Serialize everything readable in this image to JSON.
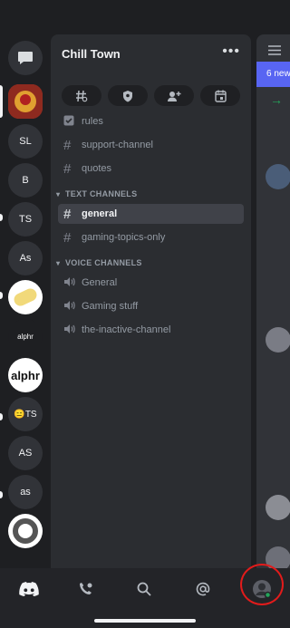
{
  "server": {
    "name": "Chill Town",
    "more_label": "•••"
  },
  "rail": {
    "servers": [
      {
        "label": ""
      },
      {
        "label": ""
      },
      {
        "label": "SL"
      },
      {
        "label": "B"
      },
      {
        "label": "TS"
      },
      {
        "label": "As"
      },
      {
        "label": ""
      },
      {
        "label": "alphr"
      },
      {
        "label": "alphr"
      },
      {
        "label": "😑TS"
      },
      {
        "label": "AS"
      },
      {
        "label": "as"
      },
      {
        "label": ""
      }
    ]
  },
  "toolbar": {
    "icons": [
      "threads-icon",
      "boost-icon",
      "invite-icon",
      "events-icon"
    ]
  },
  "channels": {
    "top": [
      {
        "name": "rules",
        "icon": "rules-icon"
      },
      {
        "name": "support-channel",
        "icon": "hash-icon"
      },
      {
        "name": "quotes",
        "icon": "hash-icon"
      }
    ],
    "text_category": "TEXT CHANNELS",
    "text": [
      {
        "name": "general",
        "active": true
      },
      {
        "name": "gaming-topics-only",
        "active": false
      }
    ],
    "voice_category": "VOICE CHANNELS",
    "voice": [
      {
        "name": "General"
      },
      {
        "name": "Gaming stuff"
      },
      {
        "name": "the-inactive-channel"
      }
    ]
  },
  "peek": {
    "banner_text": "6 new"
  },
  "nav": {
    "items": [
      "home-icon",
      "friends-icon",
      "search-icon",
      "mentions-icon",
      "profile-avatar"
    ]
  },
  "colors": {
    "accent": "#5865f2",
    "highlight_ring": "#e21b1b",
    "online_green": "#23a55a"
  }
}
